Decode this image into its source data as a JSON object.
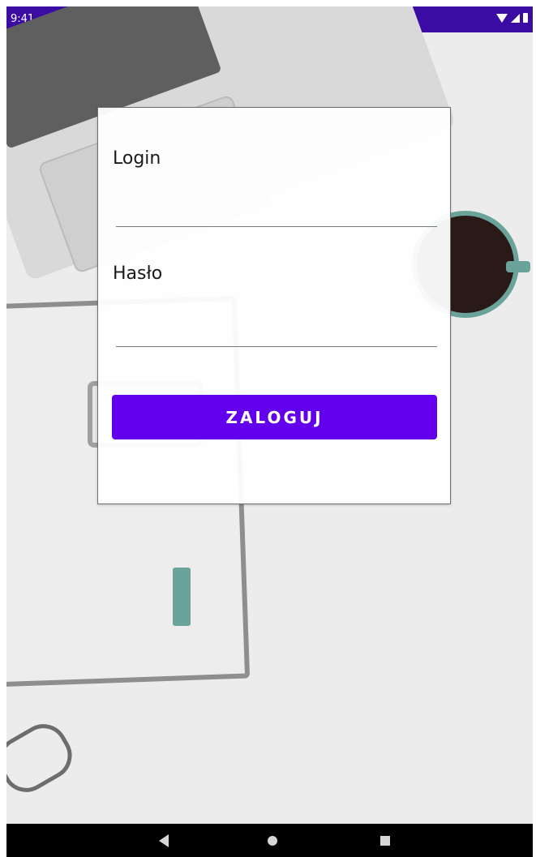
{
  "status_bar": {
    "time": "9:41",
    "left_icons": [
      "play-store-icon",
      "sd-card-icon"
    ],
    "right_icons": [
      "wifi-icon",
      "cell-signal-icon",
      "battery-icon"
    ],
    "color": "#3a0ca3"
  },
  "form": {
    "login_label": "Login",
    "login_value": "",
    "password_label": "Hasło",
    "password_value": "",
    "submit_label": "ZALOGUJ",
    "accent_color": "#6200ee"
  },
  "nav_bar": {
    "icons": [
      "back-icon",
      "home-icon",
      "recents-icon"
    ]
  }
}
